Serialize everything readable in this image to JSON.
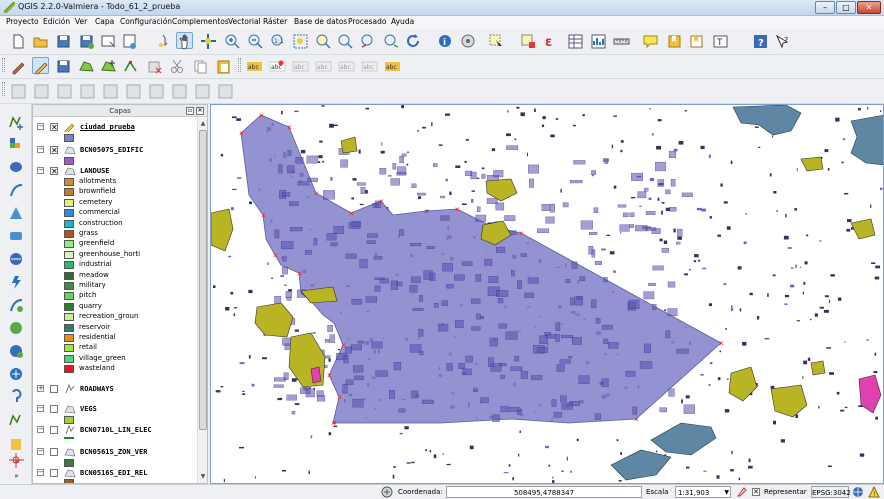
{
  "window": {
    "title": "QGIS 2.2.0-Valmiera - Todo_61_2_prueba",
    "minimize": "–",
    "maximize": "□",
    "close": "✕"
  },
  "menu": [
    "Proyecto",
    "Edición",
    "Ver",
    "Capa",
    "Configuración",
    "Complementos",
    "Vectorial",
    "Ráster",
    "Base de datos",
    "Procesado",
    "Ayuda"
  ],
  "panel": {
    "title": "Capas",
    "float_button": "▫",
    "close_button": "✕"
  },
  "layers": [
    {
      "name": "ciudad_prueba",
      "checked": true,
      "expanded": true,
      "icon": "pencil-edit-icon",
      "color": "#7f80c8"
    },
    {
      "name": "BCN0507S_EDIFIC",
      "checked": true,
      "expanded": true,
      "icon": "polygon-layer-icon",
      "color": "#9b59d4"
    },
    {
      "name": "LANDUSE",
      "checked": true,
      "expanded": true,
      "icon": "polygon-layer-icon"
    },
    {
      "name": "ROADWAYS",
      "checked": false,
      "expanded": false,
      "icon": "line-layer-icon"
    },
    {
      "name": "VEGS",
      "checked": false,
      "expanded": true,
      "icon": "polygon-layer-icon",
      "color": "#a0d030"
    },
    {
      "name": "BCN0710L_LIN_ELEC",
      "checked": false,
      "expanded": true,
      "icon": "line-layer-icon",
      "color": "#1a8a2a"
    },
    {
      "name": "BCN0561S_ZON_VER",
      "checked": false,
      "expanded": true,
      "icon": "polygon-layer-icon",
      "color": "#3a7a3a"
    },
    {
      "name": "BCN0516S_EDI_REL",
      "checked": false,
      "expanded": true,
      "icon": "polygon-layer-icon",
      "color": "#8a6a2a"
    }
  ],
  "landuse_classes": [
    {
      "label": "allotments",
      "color": "#d28a3a"
    },
    {
      "label": "brownfield",
      "color": "#c77a2e"
    },
    {
      "label": "cemetery",
      "color": "#e4ef72"
    },
    {
      "label": "commercial",
      "color": "#2a8fe0"
    },
    {
      "label": "construction",
      "color": "#18b8c8"
    },
    {
      "label": "grass",
      "color": "#b94f1a"
    },
    {
      "label": "greenfield",
      "color": "#8ef07a"
    },
    {
      "label": "greenhouse_horti",
      "color": "#d9f2c4"
    },
    {
      "label": "industrial",
      "color": "#1fbf6a"
    },
    {
      "label": "meadow",
      "color": "#2e6b2e"
    },
    {
      "label": "military",
      "color": "#3b8e3b"
    },
    {
      "label": "pitch",
      "color": "#66d266"
    },
    {
      "label": "quarry",
      "color": "#2e7d2e"
    },
    {
      "label": "recreation_groun",
      "color": "#c8ec92"
    },
    {
      "label": "reservoir",
      "color": "#2d7f6f"
    },
    {
      "label": "residential",
      "color": "#e98d1a"
    },
    {
      "label": "retail",
      "color": "#9fe43a"
    },
    {
      "label": "village_green",
      "color": "#55cf7a"
    },
    {
      "label": "wasteland",
      "color": "#e01a1a"
    }
  ],
  "status": {
    "coord_label": "Coordenada:",
    "coord_value": "508495,4788347",
    "scale_label": "Escala",
    "scale_value": "1:31,903",
    "render_label": "Representar",
    "render_checked": true,
    "crs": "EPSG:3042"
  },
  "colors": {
    "city_polygon": "#7f80c8",
    "buildings": "#5a4fb0",
    "vegetation": "#b9b424",
    "water": "#5d87a3",
    "highlight": "#e040b0"
  }
}
